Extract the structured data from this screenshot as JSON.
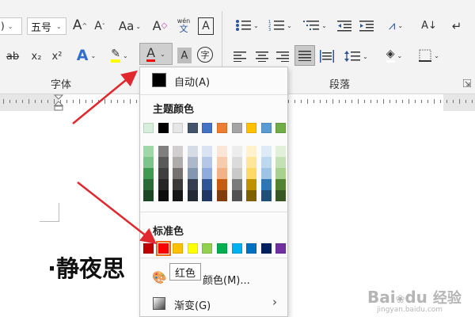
{
  "ribbon": {
    "font_size_value": "五号",
    "font_group_label": "字体",
    "para_group_label": "段落",
    "glyphs": {
      "grow": "A",
      "shrink": "A",
      "case": "Aa",
      "clear": "A",
      "phonetic_top": "wén",
      "phonetic_bottom": "文",
      "border_char": "A",
      "subscript": "x₂",
      "superscript": "x²",
      "effects": "A",
      "font_color": "A",
      "shade": "A",
      "enclose": "字",
      "sort": "A↓"
    }
  },
  "document": {
    "text": "·静夜思"
  },
  "color_menu": {
    "auto_label": "自动(A)",
    "theme_title": "主题颜色",
    "standard_title": "标准色",
    "more_label": "颜色(M)...",
    "gradient_label": "渐变(G)",
    "tooltip": "红色",
    "theme_top": [
      "#d6eedb",
      "#000000",
      "#e7e6e6",
      "#44546a",
      "#4472c4",
      "#ed7d31",
      "#a5a5a5",
      "#ffc000",
      "#5b9bd5",
      "#70ad47"
    ],
    "theme_shades": [
      [
        "#9fd7a9",
        "#7f7f7f",
        "#d0cece",
        "#d6dce5",
        "#dae3f3",
        "#fbe5d6",
        "#ededed",
        "#fff2cc",
        "#deebf7",
        "#e2f0d9"
      ],
      [
        "#7cc48b",
        "#595959",
        "#aeabab",
        "#adb9ca",
        "#b4c7e7",
        "#f8cbad",
        "#dbdbdb",
        "#ffe699",
        "#bdd7ee",
        "#c5e0b4"
      ],
      [
        "#3f9b52",
        "#3f3f3f",
        "#757171",
        "#8497b0",
        "#8faadc",
        "#f4b183",
        "#c9c9c9",
        "#ffd966",
        "#9dc3e6",
        "#a9d18e"
      ],
      [
        "#2a6b37",
        "#262626",
        "#3b3838",
        "#333f50",
        "#2f5597",
        "#c55a11",
        "#7b7b7b",
        "#bf9000",
        "#2e75b6",
        "#548235"
      ],
      [
        "#1c4725",
        "#0c0c0c",
        "#171616",
        "#222a35",
        "#1f3864",
        "#843c0c",
        "#525252",
        "#7f6000",
        "#1f4e79",
        "#385723"
      ]
    ],
    "standard_colors": [
      "#c00000",
      "#ff0000",
      "#ffc000",
      "#ffff00",
      "#92d050",
      "#00b050",
      "#00b0f0",
      "#0070c0",
      "#002060",
      "#7030a0"
    ],
    "font_color_accent": "#ff0000"
  },
  "annotation_color": "#e0282e",
  "watermark": {
    "brand": "Bai",
    "paw": "du",
    "product": "经验",
    "url": "jingyan.baidu.com"
  }
}
